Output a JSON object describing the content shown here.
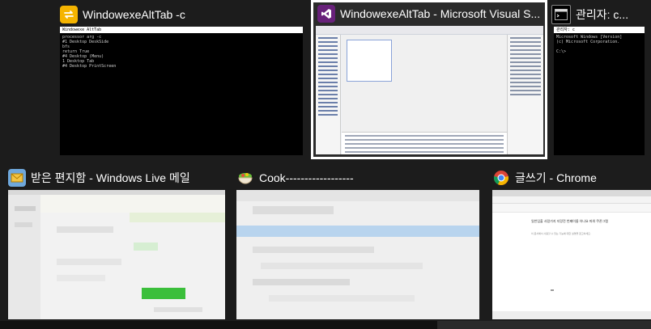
{
  "windows": [
    {
      "title": "WindowexeAltTab -c",
      "icon": "switch-arrows-icon",
      "accent": "#f5b400"
    },
    {
      "title": "WindowexeAltTab - Microsoft Visual S...",
      "icon": "visual-studio-icon",
      "accent": "#68217a"
    },
    {
      "title": "관리자: c...",
      "icon": "command-prompt-icon",
      "accent": "#000000"
    },
    {
      "title": "받은 편지함 - Windows Live 메일",
      "icon": "windows-live-mail-icon",
      "accent": "#e8a317"
    },
    {
      "title": "Cook------------------",
      "icon": "cook-bowl-icon",
      "accent": "#4caf50"
    },
    {
      "title": "글쓰기 - Chrome",
      "icon": "chrome-icon",
      "accent": "#4285f4"
    }
  ],
  "console_thumb": {
    "titlebar": "Windowexe AltTab",
    "lines": "processor arg -c\n#1 Desktop DeskSide\nbfs\nreturn True\n#4 Desktop (Menu)\n1 Desktop Tab\n#4 Desktop PrintScreen"
  },
  "admin_thumb": {
    "titlebar": "관리자: c",
    "lines": "Microsoft Windows [Version]\n(c) Microsoft Corporation.\n\nC:\\>"
  },
  "chrome_thumb": {
    "heading": "일반입출 사람가지 지랑전 번째이름 아나요 파워 쿠폰그램",
    "line": "이 문서에서 사용할 수 있는 기능에 대한 설명을 참고하세요."
  }
}
